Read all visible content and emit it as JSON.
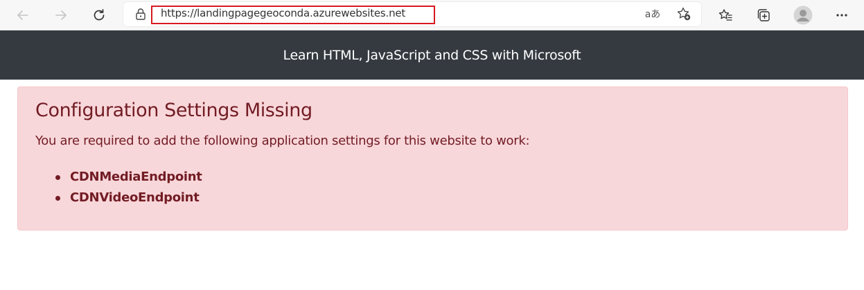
{
  "browser": {
    "url": "https://landingpagegeoconda.azurewebsites.net",
    "read_aloud_label": "aあ",
    "icons": {
      "back": "back-arrow-icon",
      "forward": "forward-arrow-icon",
      "refresh": "refresh-icon",
      "lock": "lock-icon",
      "read_aloud": "read-aloud-icon",
      "add_favorite": "add-favorite-icon",
      "favorites": "favorites-icon",
      "collections": "collections-icon",
      "profile": "profile-avatar-icon",
      "more": "more-menu-icon"
    }
  },
  "site": {
    "header_title": "Learn HTML, JavaScript and CSS with Microsoft"
  },
  "alert": {
    "heading": "Configuration Settings Missing",
    "message": "You are required to add the following application settings for this website to work:",
    "items": [
      "CDNMediaEndpoint",
      "CDNVideoEndpoint"
    ],
    "colors": {
      "background": "#f8d7da",
      "text": "#721c24",
      "border": "#f5c6cb"
    }
  },
  "colors": {
    "header_background": "#343a40",
    "url_highlight": "#d71920"
  }
}
